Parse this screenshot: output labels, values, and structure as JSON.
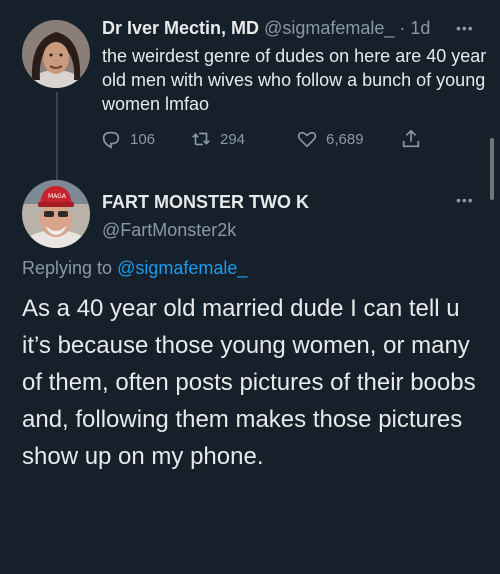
{
  "parent_tweet": {
    "display_name": "Dr Iver Mectin, MD",
    "handle": "@sigmafemale_",
    "separator": "·",
    "time": "1d",
    "more_icon": "ellipsis-icon",
    "text": "the weirdest genre of dudes on here are 40 year old men with wives who follow a bunch of young women lmfao",
    "actions": {
      "reply_count": "106",
      "retweet_count": "294",
      "like_count": "6,689"
    }
  },
  "reply_tweet": {
    "display_name": "FART MONSTER TWO K",
    "handle": "@FartMonster2k",
    "replying_prefix": "Replying to",
    "replying_to": "@sigmafemale_",
    "text": "As a 40 year old married dude I can tell u it’s because those young women, or many of them, often posts pictures of their boobs and, following them makes those pictures show up on my phone."
  },
  "colors": {
    "background": "#15202b",
    "text": "#e7e9ea",
    "muted": "#8b98a5",
    "accent": "#1d9bf0"
  }
}
